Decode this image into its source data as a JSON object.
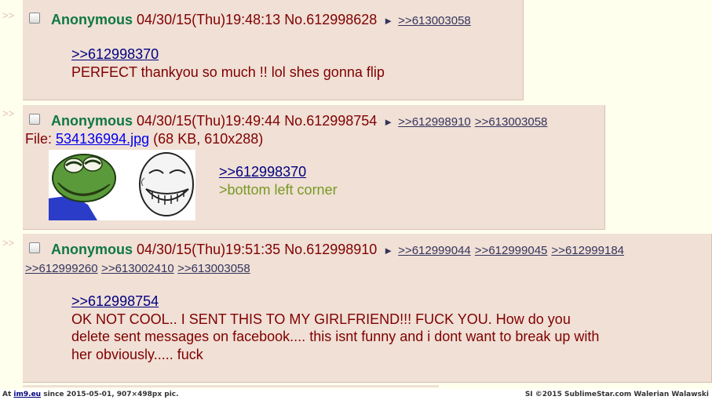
{
  "side_marker": ">>",
  "posts": [
    {
      "name": "Anonymous",
      "datetime": "04/30/15(Thu)19:48:13",
      "post_no": "No.612998628",
      "arrow": "►",
      "replies": [
        ">>613003058"
      ],
      "quote": ">>612998370",
      "body": "PERFECT thankyou so much !! lol shes gonna flip"
    },
    {
      "name": "Anonymous",
      "datetime": "04/30/15(Thu)19:49:44",
      "post_no": "No.612998754",
      "arrow": "►",
      "replies": [
        ">>612998910",
        ">>613003058"
      ],
      "file_prefix": "File:",
      "file_name": "534136994.jpg",
      "file_info": "(68 KB, 610x288)",
      "quote": ">>612998370",
      "greentext": ">bottom left corner"
    },
    {
      "name": "Anonymous",
      "datetime": "04/30/15(Thu)19:51:35",
      "post_no": "No.612998910",
      "arrow": "►",
      "replies": [
        ">>612999044",
        ">>612999045",
        ">>612999184",
        ">>612999260",
        ">>613002410",
        ">>613003058"
      ],
      "quote": ">>612998754",
      "body_lines": [
        "OK NOT COOL.. I SENT THIS TO MY GIRLFRIEND!!! FUCK YOU. How do you",
        "delete sent messages on facebook.... this isnt funny and i dont want to break up with",
        "her obviously..... fuck"
      ]
    }
  ],
  "footer": {
    "left_prefix": "At",
    "left_link": "im9.eu",
    "left_suffix": "since 2015-05-01, 907×498px pic.",
    "right": "SI ©2015 SublimeStar.com Walerian Walawski"
  }
}
